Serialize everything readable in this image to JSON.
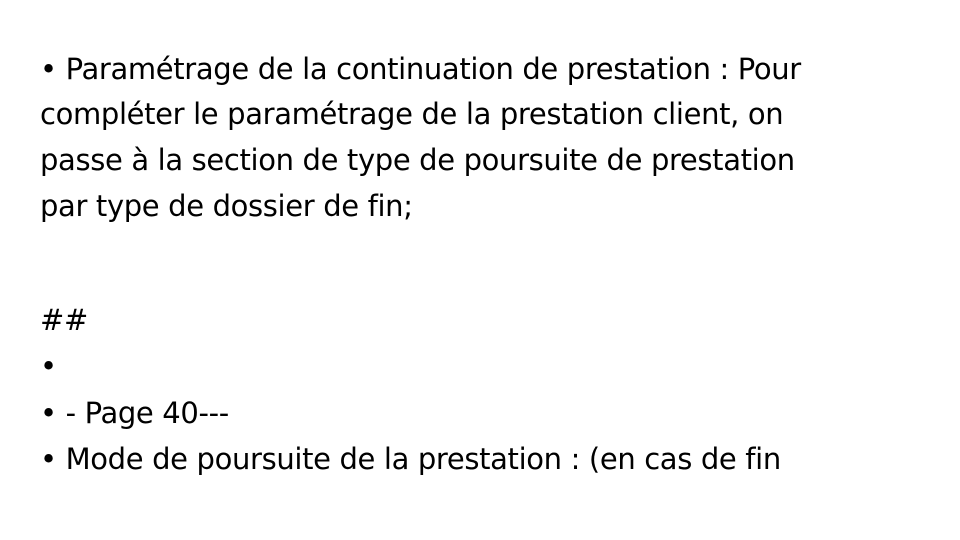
{
  "slide": {
    "lines": [
      "• Paramétrage de la continuation de prestation : Pour",
      "compléter le paramétrage de la prestation client, on",
      "passe à la section de type de poursuite de prestation",
      "par type de dossier de fin;",
      "##",
      "•",
      "• - Page 40---",
      "• Mode de poursuite de la prestation : (en cas de fin"
    ]
  }
}
